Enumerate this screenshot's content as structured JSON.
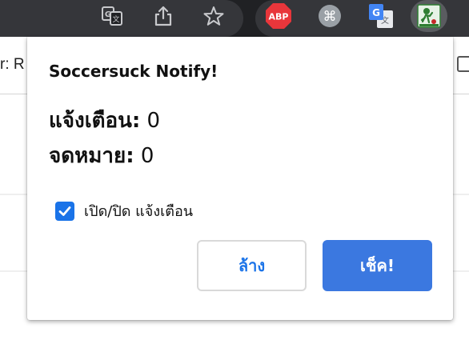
{
  "toolbar": {
    "icons": [
      "translate-page-icon",
      "share-icon",
      "bookmark-star-icon",
      "adblock-plus-icon",
      "command-extension-icon",
      "google-translate-icon",
      "soccersuck-extension-icon"
    ],
    "abp_label": "ABP",
    "gtrans_label": "G"
  },
  "page": {
    "partial_text": "r: R"
  },
  "popup": {
    "title": "Soccersuck Notify!",
    "notify_label": "แจ้งเตือน:",
    "notify_count": "0",
    "mail_label": "จดหมาย:",
    "mail_count": "0",
    "toggle_label": "เปิด/ปิด แจ้งเตือน",
    "toggle_checked": true,
    "clear_button": "ล้าง",
    "check_button": "เช็ค!"
  },
  "colors": {
    "toolbar_bg": "#202124",
    "accent": "#1a73e8",
    "check_button_bg": "#3b78e0",
    "abp_red": "#e8363b"
  }
}
